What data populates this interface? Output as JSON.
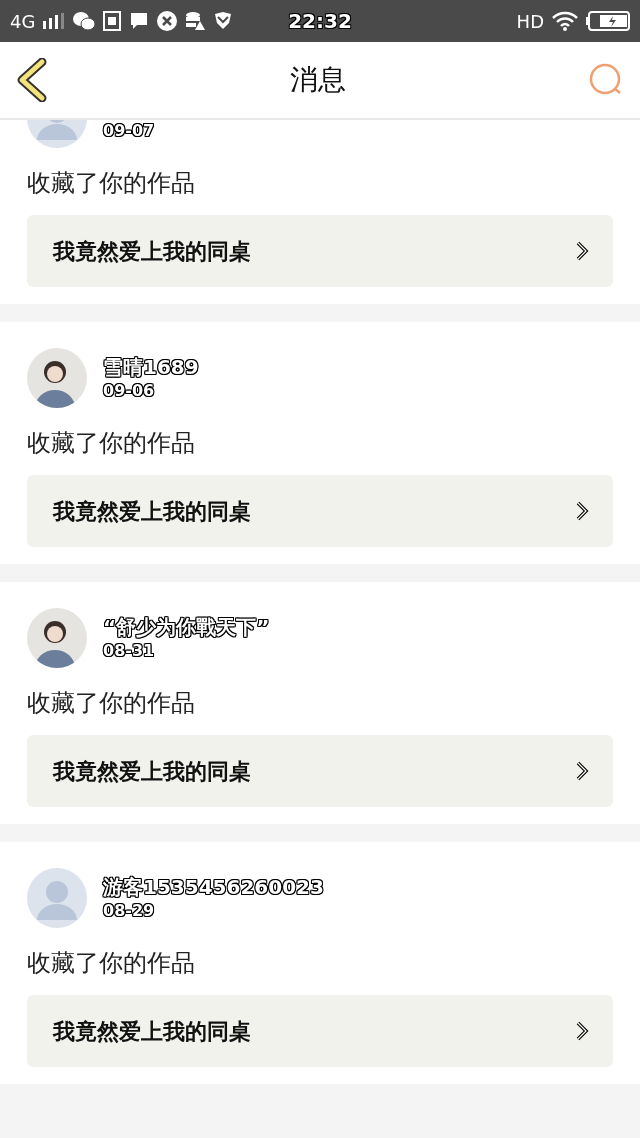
{
  "status_bar": {
    "network": "4G",
    "time": "22:32",
    "hd": "HD"
  },
  "header": {
    "title": "消息"
  },
  "messages": [
    {
      "avatar": {
        "kind": "default"
      },
      "date": "09-07",
      "action": "收藏了你的作品",
      "work": "我竟然爱上我的同桌"
    },
    {
      "name": "雪晴1689",
      "date": "09-06",
      "action": "收藏了你的作品",
      "work": "我竟然爱上我的同桌"
    },
    {
      "name": "“舒少为你戰天下”",
      "date": "08-31",
      "action": "收藏了你的作品",
      "work": "我竟然爱上我的同桌"
    },
    {
      "avatar": {
        "kind": "default"
      },
      "name": "游客1535456260023",
      "date": "08-29",
      "action": "收藏了你的作品",
      "work": "我竟然爱上我的同桌"
    }
  ]
}
